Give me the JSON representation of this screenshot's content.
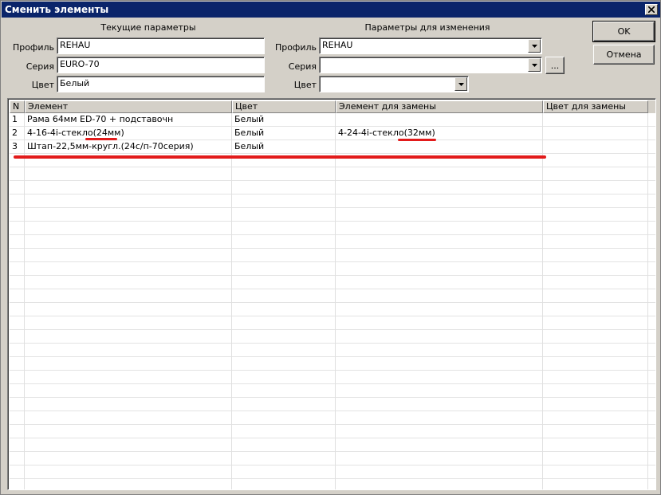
{
  "window": {
    "title": "Сменить элементы"
  },
  "current": {
    "group_title": "Текущие параметры",
    "profile_label": "Профиль",
    "profile_value": "REHAU",
    "series_label": "Серия",
    "series_value": "EURO-70",
    "color_label": "Цвет",
    "color_value": "Белый"
  },
  "target": {
    "group_title": "Параметры для изменения",
    "profile_label": "Профиль",
    "profile_value": "REHAU",
    "series_label": "Серия",
    "series_value": "",
    "color_label": "Цвет",
    "color_value": "",
    "browse_label": "..."
  },
  "buttons": {
    "ok": "OK",
    "cancel": "Отмена"
  },
  "table": {
    "columns": [
      "N",
      "Элемент",
      "Цвет",
      "Элемент для замены",
      "Цвет для замены"
    ],
    "rows": [
      {
        "n": "1",
        "element": "Рама 64мм ED-70 + подставочн",
        "color": "Белый",
        "replace_element": "",
        "replace_color": ""
      },
      {
        "n": "2",
        "element": "4-16-4i-стекло(24мм)",
        "color": "Белый",
        "replace_element": "4-24-4i-стекло(32мм)",
        "replace_color": ""
      },
      {
        "n": "3",
        "element": "Штап-22,5мм-кругл.(24с/п-70серия)",
        "color": "Белый",
        "replace_element": "",
        "replace_color": ""
      }
    ]
  },
  "colors": {
    "titlebar": "#0a246a",
    "face": "#d4d0c8",
    "annotation": "#e21b1b"
  }
}
